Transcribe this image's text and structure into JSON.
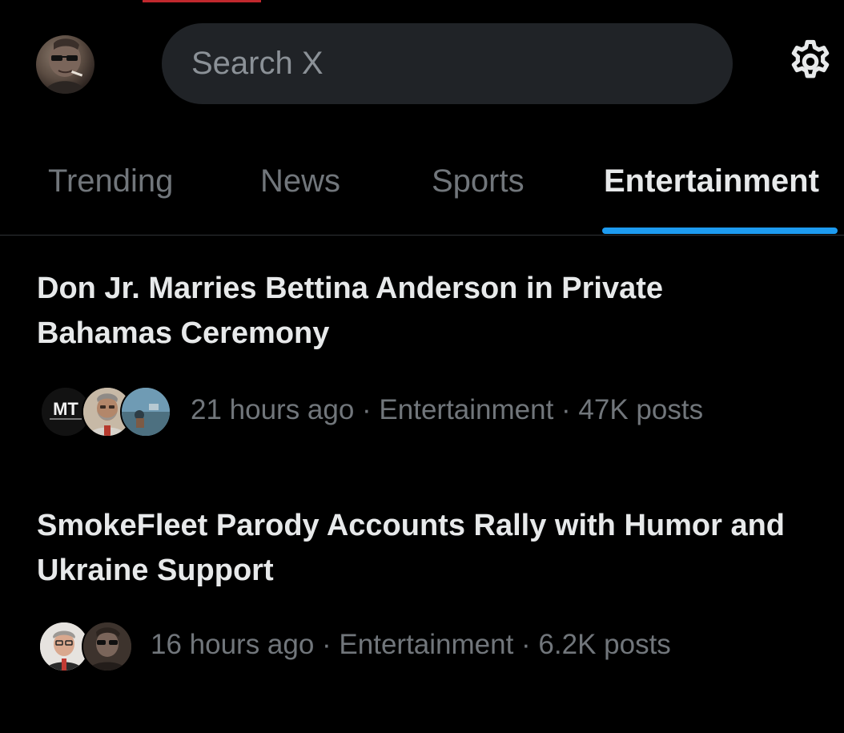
{
  "search": {
    "placeholder": "Search X"
  },
  "header": {
    "avatar_icon": "profile-avatar",
    "settings_icon": "gear-icon"
  },
  "tabs": [
    {
      "label": "Trending",
      "active": false
    },
    {
      "label": "News",
      "active": false
    },
    {
      "label": "Sports",
      "active": false
    },
    {
      "label": "Entertainment",
      "active": true
    }
  ],
  "stories": [
    {
      "title": "Don Jr. Marries Bettina Anderson in Private Bahamas Ceremony",
      "meta": "21 hours ago · Entertainment · 47K posts",
      "avatars": [
        {
          "label": "MT",
          "icon": "mt-logo-avatar"
        },
        {
          "icon": "bearded-man-avatar"
        },
        {
          "icon": "landscape-avatar"
        }
      ]
    },
    {
      "title": "SmokeFleet Parody Accounts Rally with Humor and Ukraine Support",
      "meta": "16 hours ago · Entertainment · 6.2K posts",
      "avatars": [
        {
          "icon": "glasses-man-avatar"
        },
        {
          "icon": "sunglasses-man-avatar"
        }
      ]
    }
  ],
  "colors": {
    "background": "#000000",
    "search_bg": "#202327",
    "accent": "#1d9bf0",
    "text_primary": "#e7e9ea",
    "text_secondary": "#71767b",
    "divider": "#2f3336",
    "top_accent": "#c0282d"
  }
}
